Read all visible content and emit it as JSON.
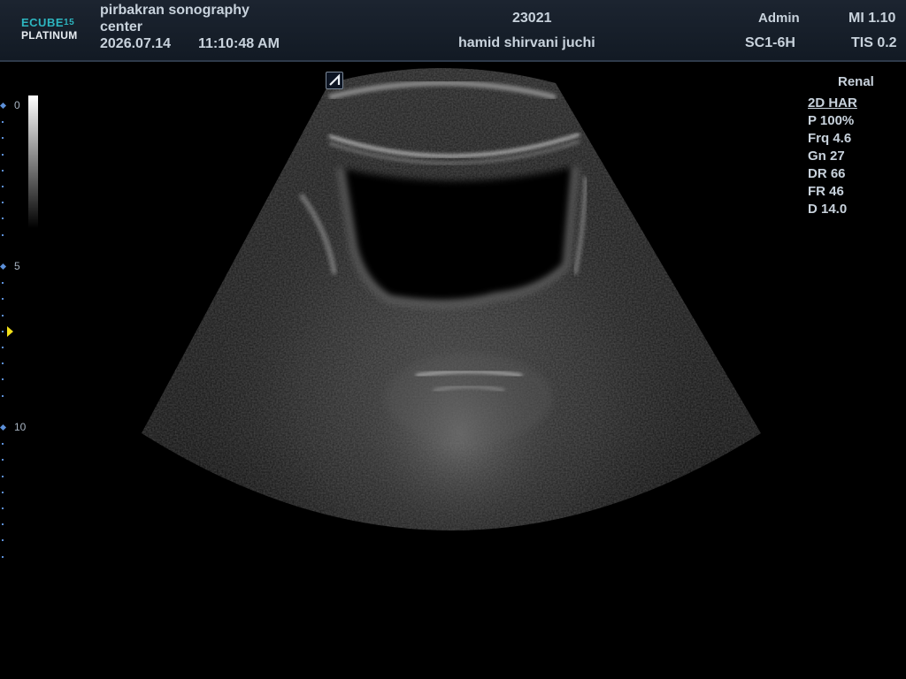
{
  "header": {
    "logo": {
      "brand": "ECUBE",
      "model_number": "15",
      "edition": "PLATINUM"
    },
    "institution_line1": "pirbakran sonography",
    "institution_line2": "center",
    "date": "2026.07.14",
    "time": "11:10:48  AM",
    "patient_id": "23021",
    "patient_name": "hamid shirvani juchi",
    "user": "Admin",
    "probe": "SC1-6H",
    "mi": "MI 1.10",
    "tis": "TIS 0.2"
  },
  "depth_scale": {
    "labels": [
      "0",
      "5",
      "10"
    ],
    "max_depth_cm": 14.0,
    "focus_depth_cm": 7.0
  },
  "parameters": {
    "preset": "Renal",
    "mode": "2D HAR",
    "items": [
      "P 100%",
      "Frq 4.6",
      "Gn 27",
      "DR 66",
      "FR 46",
      "D 14.0"
    ]
  },
  "icons": {
    "orientation_marker": "orientation-marker-icon",
    "focus_marker": "focus-marker-icon"
  },
  "colors": {
    "header_bg": "#1c2430",
    "logo_accent": "#2db6c0",
    "depth_marks": "#5c8fd8",
    "focus_marker": "#f2e01a",
    "text": "#c8d2dc"
  }
}
